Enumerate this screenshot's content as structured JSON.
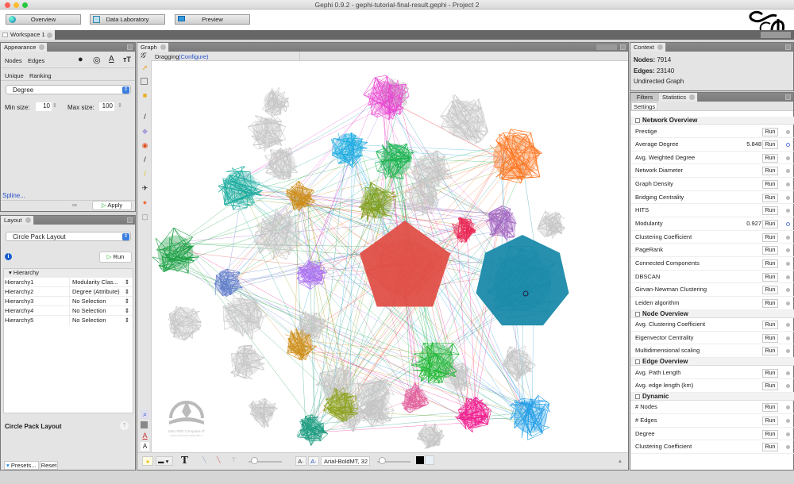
{
  "window": {
    "title": "Gephi 0.9.2 - gephi-tutorial-final-result.gephi - Project 2"
  },
  "modes": [
    {
      "label": "Overview",
      "icon": "globe-icon"
    },
    {
      "label": "Data Laboratory",
      "icon": "table-icon"
    },
    {
      "label": "Preview",
      "icon": "monitor-icon"
    }
  ],
  "workspace": {
    "tab": "Workspace 1"
  },
  "appearance": {
    "tab": "Appearance",
    "element_tabs": [
      "Nodes",
      "Edges"
    ],
    "mode_tabs": [
      "Unique",
      "Ranking"
    ],
    "attribute": "Degree",
    "min_label": "Min size:",
    "min_value": "10",
    "max_label": "Max size:",
    "max_value": "100",
    "spline": "Spline...",
    "apply": "Apply"
  },
  "layout": {
    "tab": "Layout",
    "algorithm": "Circle Pack Layout",
    "run": "Run",
    "section": "Hierarchy",
    "rows": [
      {
        "key": "Hierarchy1",
        "value": "Modularity Clas..."
      },
      {
        "key": "Hierarchy2",
        "value": "Degree (Attribute)"
      },
      {
        "key": "Hierarchy3",
        "value": "No Selection"
      },
      {
        "key": "Hierarchy4",
        "value": "No Selection"
      },
      {
        "key": "Hierarchy5",
        "value": "No Selection"
      }
    ],
    "description_title": "Circle Pack Layout",
    "presets": "Presets...",
    "reset": "Reset"
  },
  "graph": {
    "tab": "Graph",
    "mode": "Dragging",
    "configure": "(Configure)",
    "font": "Arial-BoldMT, 32",
    "watermark_line1": "MSc-PhD Computer-IT",
    "watermark_line2": "www.tutorialcomputer.ir",
    "clusters": [
      {
        "color": "#e83fcf"
      },
      {
        "color": "#13a8e0"
      },
      {
        "color": "#12b04a"
      },
      {
        "color": "#ff6a0d"
      },
      {
        "color": "#12a89a"
      },
      {
        "color": "#cc8a12"
      },
      {
        "color": "#7a9a12"
      },
      {
        "color": "#e81b4a"
      },
      {
        "color": "#a060c0"
      },
      {
        "color": "#0f9a3a"
      },
      {
        "color": "#e05048"
      },
      {
        "color": "#1a8aaa"
      },
      {
        "color": "#5b78c8"
      },
      {
        "color": "#a96ef0"
      },
      {
        "color": "#cc8a12"
      },
      {
        "color": "#14b428"
      },
      {
        "color": "#8a9e12"
      },
      {
        "color": "#e05a98"
      },
      {
        "color": "#f0108a"
      },
      {
        "color": "#1a9ae8"
      },
      {
        "color": "#12987a"
      }
    ]
  },
  "context": {
    "tab": "Context",
    "nodes_label": "Nodes:",
    "nodes": "7914",
    "edges_label": "Edges:",
    "edges": "23140",
    "type": "Undirected Graph"
  },
  "statistics": {
    "tabs": [
      "Filters",
      "Statistics"
    ],
    "settings": "Settings",
    "run_label": "Run",
    "groups": [
      {
        "title": "Network Overview",
        "items": [
          {
            "label": "Prestige",
            "value": ""
          },
          {
            "label": "Average Degree",
            "value": "5.848",
            "info": true
          },
          {
            "label": "Avg. Weighted Degree",
            "value": ""
          },
          {
            "label": "Network Diameter",
            "value": ""
          },
          {
            "label": "Graph Density",
            "value": ""
          },
          {
            "label": "Bridging Centrality",
            "value": ""
          },
          {
            "label": "HITS",
            "value": ""
          },
          {
            "label": "Modularity",
            "value": "0.927",
            "info": true
          },
          {
            "label": "Clustering Coefficient",
            "value": ""
          },
          {
            "label": "PageRank",
            "value": ""
          },
          {
            "label": "Connected Components",
            "value": ""
          },
          {
            "label": "DBSCAN",
            "value": ""
          },
          {
            "label": "Girvan-Newman Clustering",
            "value": ""
          },
          {
            "label": "Leiden algorithm",
            "value": ""
          }
        ]
      },
      {
        "title": "Node Overview",
        "items": [
          {
            "label": "Avg. Clustering Coefficient",
            "value": ""
          },
          {
            "label": "Eigenvector Centrality",
            "value": ""
          },
          {
            "label": "Multidimensional scaling",
            "value": ""
          }
        ]
      },
      {
        "title": "Edge Overview",
        "items": [
          {
            "label": "Avg. Path Length",
            "value": ""
          },
          {
            "label": "Avg. edge length (km)",
            "value": ""
          }
        ]
      },
      {
        "title": "Dynamic",
        "items": [
          {
            "label": "# Nodes",
            "value": ""
          },
          {
            "label": "# Edges",
            "value": ""
          },
          {
            "label": "Degree",
            "value": ""
          },
          {
            "label": "Clustering Coefficient",
            "value": ""
          }
        ]
      }
    ]
  }
}
